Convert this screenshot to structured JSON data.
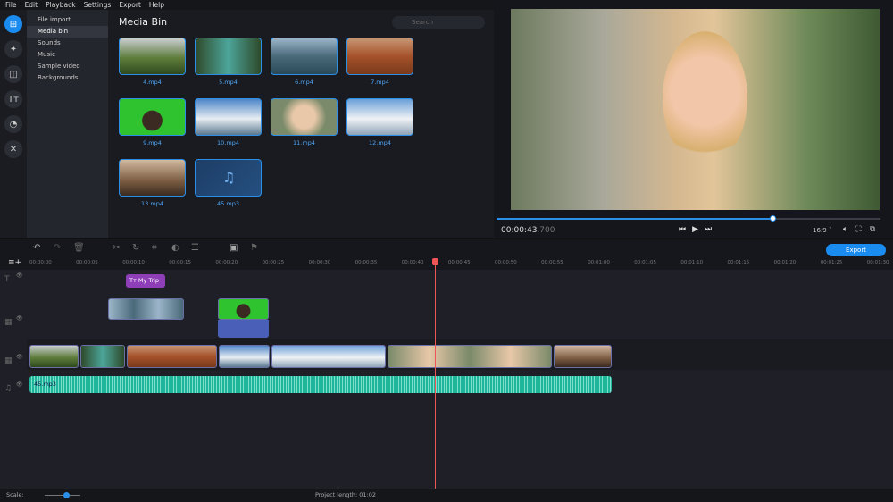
{
  "menu": [
    "File",
    "Edit",
    "Playback",
    "Settings",
    "Export",
    "Help"
  ],
  "tools": [
    {
      "icon": "import-icon",
      "active": true
    },
    {
      "icon": "magic-wand-icon"
    },
    {
      "icon": "transitions-icon"
    },
    {
      "icon": "titles-icon"
    },
    {
      "icon": "stickers-icon"
    },
    {
      "icon": "tools-icon"
    }
  ],
  "sidebar": {
    "items": [
      "File import",
      "Media bin",
      "Sounds",
      "Music",
      "Sample video",
      "Backgrounds"
    ],
    "active": 1
  },
  "bin": {
    "title": "Media Bin",
    "search_placeholder": "Search",
    "items": [
      {
        "name": "4.mp4",
        "bg": "linear-gradient(#c9cdd0,#5e7d3b 55%,#2f4a1e)"
      },
      {
        "name": "5.mp4",
        "bg": "linear-gradient(90deg,#2f4a2a,#4ca59a 50%,#2e4a2a)"
      },
      {
        "name": "6.mp4",
        "bg": "linear-gradient(#9bb4c9,#4a6a7a 50%,#2a4a5a)"
      },
      {
        "name": "7.mp4",
        "bg": "linear-gradient(#c79673,#a5522a 50%,#7a3a1c)"
      },
      {
        "name": "9.mp4",
        "bg": "radial-gradient(circle at 50% 60%,#3a2a22 25%,#2fc42f 27%)"
      },
      {
        "name": "10.mp4",
        "bg": "linear-gradient(#4d86c8,#e8edf2 55%,#5a7890)"
      },
      {
        "name": "11.mp4",
        "bg": "radial-gradient(circle at 50% 50%,#e8c8a8 30%,#7a8a6a 60%)"
      },
      {
        "name": "12.mp4",
        "bg": "linear-gradient(#6aa0d8,#f0f2f5 55%,#8fa4b8)"
      },
      {
        "name": "13.mp4",
        "bg": "linear-gradient(#d2b9a0,#7a5a40 60%,#3a2a20)"
      },
      {
        "name": "45.mp3",
        "bg": "linear-gradient(135deg,#1d3e66,#254f80)",
        "audio": true
      }
    ]
  },
  "preview": {
    "timecode_main": "00:00:43",
    "timecode_ms": ".700",
    "progress_pct": 72,
    "aspect": "16:9"
  },
  "toolbar": {
    "export_label": "Export"
  },
  "ruler": [
    "00:00:00",
    "00:00:05",
    "00:00:10",
    "00:00:15",
    "00:00:20",
    "00:00:25",
    "00:00:30",
    "00:00:35",
    "00:00:40",
    "00:00:45",
    "00:00:50",
    "00:00:55",
    "00:01:00",
    "00:01:05",
    "00:01:10",
    "00:01:15",
    "00:01:20",
    "00:01:25",
    "00:01:30"
  ],
  "title_clip": "My Trip",
  "audio_clip": "45.mp3",
  "status": {
    "scale_label": "Scale:",
    "project_length": "Project length:  01:02"
  },
  "colors": {
    "accent": "#1a8cf0",
    "title_clip": "#8e3fb8",
    "audio": "#1fb59b",
    "playhead": "#e55555"
  }
}
